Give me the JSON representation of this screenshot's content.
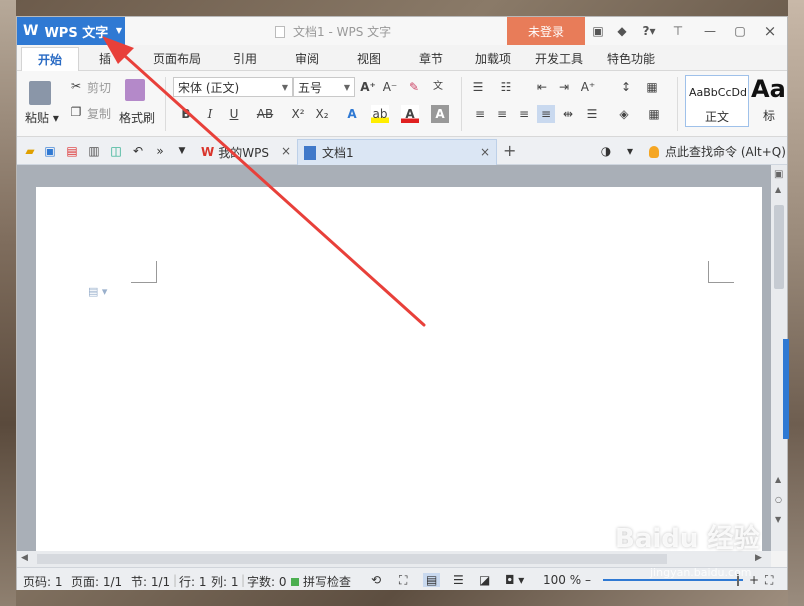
{
  "titlebar": {
    "app_name": "WPS 文字",
    "doc_title": "文档1 - WPS 文字",
    "login_label": "未登录",
    "help_label": "?"
  },
  "menu": {
    "tabs": [
      "开始",
      "插",
      "页面布局",
      "引用",
      "审阅",
      "视图",
      "章节",
      "加载项",
      "开发工具",
      "特色功能"
    ]
  },
  "ribbon": {
    "paste_label": "粘贴",
    "cut_label": "剪切",
    "copy_label": "复制",
    "format_painter_label": "格式刷",
    "font_name": "宋体 (正文)",
    "font_size": "五号",
    "style_sample": "AaBbCcDd",
    "style_name": "正文",
    "style_big": "Aa",
    "style_big_label": "标",
    "bold": "B",
    "italic": "I",
    "underline": "U",
    "strike": "AB",
    "superscript": "X²",
    "subscript": "X₂"
  },
  "quickbar": {
    "doc_tabs": [
      {
        "label": "我的WPS",
        "close": "×"
      },
      {
        "label": "文档1",
        "close": "×"
      }
    ],
    "new_tab": "+",
    "command_search": "点此查找命令 (Alt+Q)"
  },
  "statusbar": {
    "page": "页码: 1",
    "pages": "页面: 1/1",
    "section": "节: 1/1",
    "row": "行: 1",
    "col": "列: 1",
    "words": "字数: 0",
    "spellcheck": "拼写检查",
    "zoom": "100 %"
  },
  "watermark": {
    "text": "Baidu 经验",
    "sub": "jingyan.baidu.com"
  },
  "colors": {
    "accent": "#2f79d3",
    "login": "#e87c59",
    "annotation": "#e8403a"
  },
  "icons": [
    "wps-logo-icon",
    "file-icon",
    "skin-icon",
    "shirt-icon",
    "minimize-icon",
    "maximize-icon",
    "close-icon",
    "paste-icon",
    "scissors-icon",
    "copy-icon",
    "eraser-icon",
    "open-folder-icon",
    "save-icon",
    "pdf-icon",
    "print-icon",
    "preview-icon",
    "undo-icon",
    "redo-icon",
    "bulb-icon"
  ]
}
